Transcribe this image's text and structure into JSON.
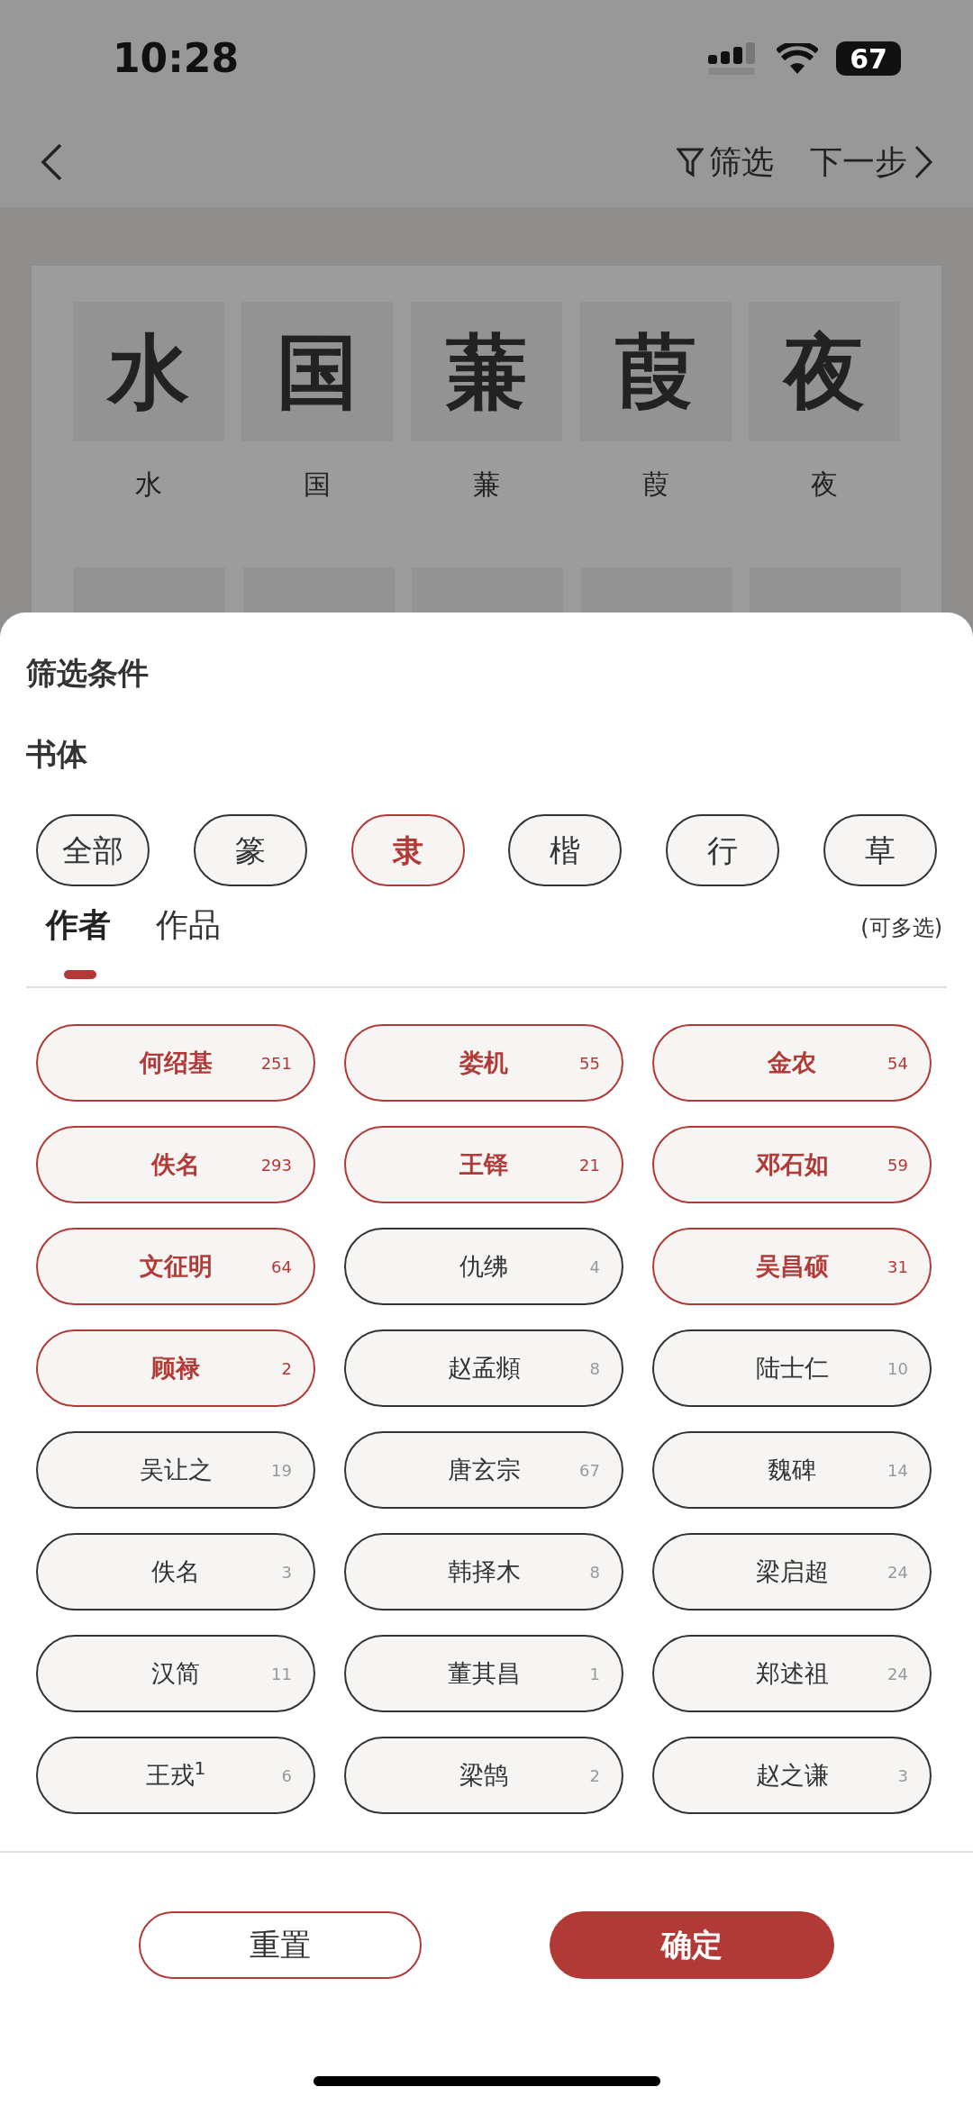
{
  "status_bar": {
    "time": "10:28",
    "battery": "67"
  },
  "nav": {
    "filter": "筛选",
    "next": "下一步"
  },
  "background_chars": [
    {
      "glyph": "水",
      "label": "水"
    },
    {
      "glyph": "国",
      "label": "国"
    },
    {
      "glyph": "蒹",
      "label": "蒹"
    },
    {
      "glyph": "葭",
      "label": "葭"
    },
    {
      "glyph": "夜",
      "label": "夜"
    }
  ],
  "sheet": {
    "title": "筛选条件",
    "script_label": "书体",
    "scripts": [
      {
        "label": "全部",
        "selected": false
      },
      {
        "label": "篆",
        "selected": false
      },
      {
        "label": "隶",
        "selected": true
      },
      {
        "label": "楷",
        "selected": false
      },
      {
        "label": "行",
        "selected": false
      },
      {
        "label": "草",
        "selected": false
      }
    ],
    "tabs": [
      {
        "label": "作者",
        "selected": true
      },
      {
        "label": "作品",
        "selected": false
      }
    ],
    "hint": "(可多选)",
    "authors": [
      {
        "name": "何绍基",
        "count": "251",
        "selected": true
      },
      {
        "name": "娄机",
        "count": "55",
        "selected": true
      },
      {
        "name": "金农",
        "count": "54",
        "selected": true
      },
      {
        "name": "佚名",
        "count": "293",
        "selected": true
      },
      {
        "name": "王铎",
        "count": "21",
        "selected": true
      },
      {
        "name": "邓石如",
        "count": "59",
        "selected": true
      },
      {
        "name": "文征明",
        "count": "64",
        "selected": true
      },
      {
        "name": "仇绋",
        "count": "4",
        "selected": false
      },
      {
        "name": "吴昌硕",
        "count": "31",
        "selected": true
      },
      {
        "name": "顾禄",
        "count": "2",
        "selected": true
      },
      {
        "name": "赵孟頫",
        "count": "8",
        "selected": false
      },
      {
        "name": "陆士仁",
        "count": "10",
        "selected": false
      },
      {
        "name": "吴让之",
        "count": "19",
        "selected": false
      },
      {
        "name": "唐玄宗",
        "count": "67",
        "selected": false
      },
      {
        "name": "魏碑",
        "count": "14",
        "selected": false
      },
      {
        "name": "佚名",
        "count": "3",
        "selected": false
      },
      {
        "name": "韩择木",
        "count": "8",
        "selected": false
      },
      {
        "name": "梁启超",
        "count": "24",
        "selected": false
      },
      {
        "name": "汉简",
        "count": "11",
        "selected": false
      },
      {
        "name": "董其昌",
        "count": "1",
        "selected": false
      },
      {
        "name": "郑述祖",
        "count": "24",
        "selected": false
      },
      {
        "name": "王戎$^{1}$",
        "count": "6",
        "selected": false
      },
      {
        "name": "梁鹄",
        "count": "2",
        "selected": false
      },
      {
        "name": "赵之谦",
        "count": "3",
        "selected": false
      }
    ],
    "reset": "重置",
    "confirm": "确定"
  }
}
